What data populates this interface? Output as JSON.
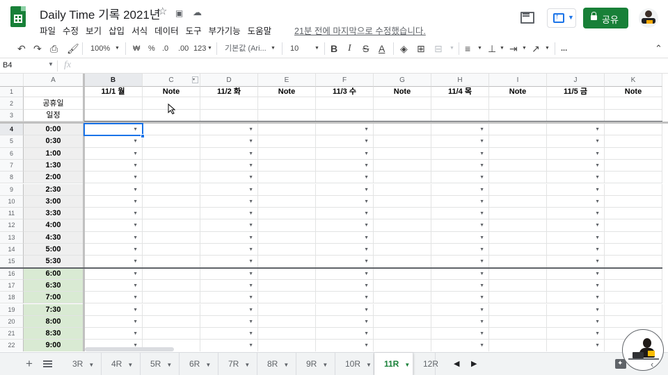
{
  "title": {
    "doc_title": "Daily Time 기록 2021년",
    "star_icon": "star-icon",
    "move_icon": "folder-move-icon",
    "cloud_icon": "cloud-status-icon",
    "last_edit": "21분 전에 마지막으로 수정했습니다.",
    "share_label": "공유",
    "menu": [
      "파일",
      "수정",
      "보기",
      "삽입",
      "서식",
      "데이터",
      "도구",
      "부가기능",
      "도움말"
    ]
  },
  "toolbar": {
    "zoom": "100%",
    "currency": "₩",
    "percent": "%",
    "dec_decrease": ".0",
    "dec_increase": ".00",
    "format_more": "123",
    "font": "기본값 (Ari...",
    "font_size": "10",
    "bold": "B",
    "italic": "I",
    "strike": "S",
    "text_color": "A",
    "more": "..."
  },
  "formula_bar": {
    "name_box": "B4",
    "fx": "fx"
  },
  "columns": [
    "A",
    "B",
    "C",
    "D",
    "E",
    "F",
    "G",
    "H",
    "I",
    "J",
    "K"
  ],
  "rows": [
    "1",
    "2",
    "3",
    "4",
    "5",
    "6",
    "7",
    "8",
    "9",
    "10",
    "11",
    "12",
    "13",
    "14",
    "15",
    "16",
    "17",
    "18",
    "19",
    "20",
    "21",
    "22"
  ],
  "header_row": [
    "",
    "11/1 월",
    "Note",
    "11/2 화",
    "Note",
    "11/3 수",
    "Note",
    "11/4 목",
    "Note",
    "11/5 금",
    "Note"
  ],
  "row2_label": "공휴일",
  "row3_label": "일정",
  "times": [
    "0:00",
    "0:30",
    "1:00",
    "1:30",
    "2:00",
    "2:30",
    "3:00",
    "3:30",
    "4:00",
    "4:30",
    "5:00",
    "5:30",
    "6:00",
    "6:30",
    "7:00",
    "7:30",
    "8:00",
    "8:30",
    "9:00"
  ],
  "colors": {
    "brand_green": "#188038",
    "selection_blue": "#1a73e8",
    "time_gray": "#efefef",
    "time_green": "#d9ead3"
  },
  "sheet_tabs": [
    "3R",
    "4R",
    "5R",
    "6R",
    "7R",
    "8R",
    "9R",
    "10R",
    "11R",
    "12R"
  ],
  "active_tab": "11R"
}
